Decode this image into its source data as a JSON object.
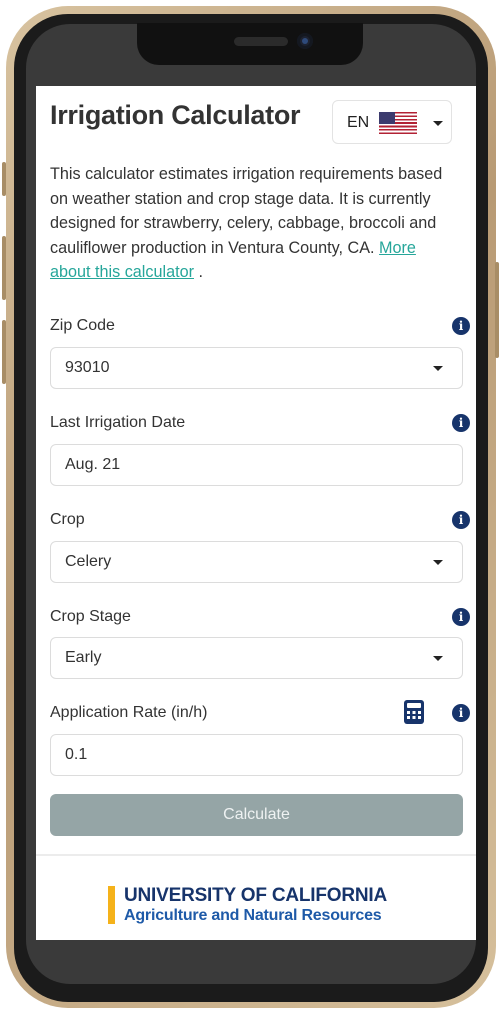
{
  "app": {
    "title": "Irrigation Calculator",
    "language": {
      "code": "EN",
      "flag_icon": "us-flag-icon"
    }
  },
  "description": {
    "text": "This calculator estimates irrigation requirements based on weather station and crop stage data. It is currently designed for strawberry, celery, cabbage, broccoli and cauliflower production in Ventura County, CA.",
    "link_text": "More about this calculator",
    "link_suffix": " ."
  },
  "fields": {
    "zip_code": {
      "label": "Zip Code",
      "value": "93010",
      "type": "select"
    },
    "last_irrigation_date": {
      "label": "Last Irrigation Date",
      "value": "Aug. 21",
      "type": "text"
    },
    "crop": {
      "label": "Crop",
      "value": "Celery",
      "type": "select"
    },
    "crop_stage": {
      "label": "Crop Stage",
      "value": "Early",
      "type": "select"
    },
    "application_rate": {
      "label": "Application Rate (in/h)",
      "value": "0.1",
      "type": "text"
    }
  },
  "actions": {
    "calculate_label": "Calculate"
  },
  "footer": {
    "org_name": "UNIVERSITY OF CALIFORNIA",
    "org_division": "Agriculture and Natural Resources"
  },
  "colors": {
    "link": "#26a69a",
    "info_icon": "#17346b",
    "calculate_button": "#95a5a6",
    "uc_gold": "#f5b21a",
    "uc_blue": "#17346b"
  }
}
